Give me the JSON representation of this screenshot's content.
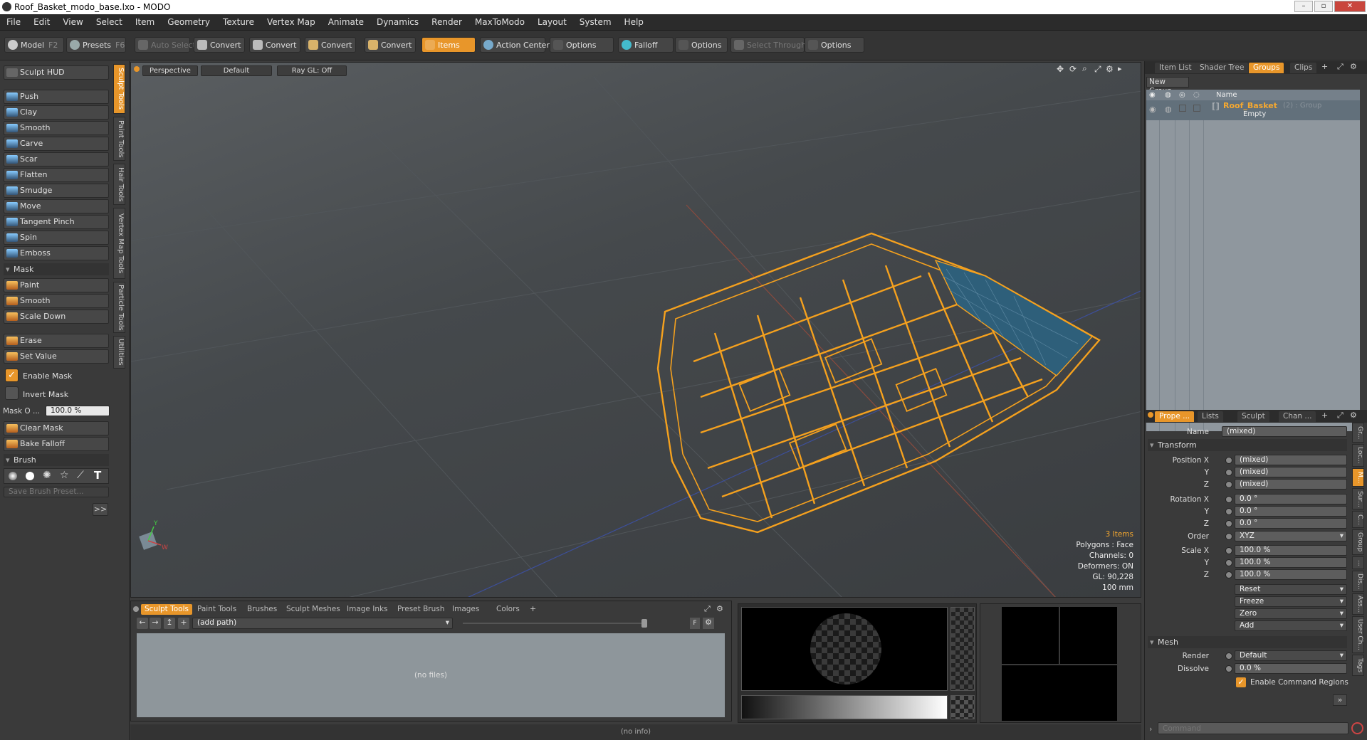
{
  "window": {
    "title": "Roof_Basket_modo_base.lxo - MODO"
  },
  "menu": [
    "File",
    "Edit",
    "View",
    "Select",
    "Item",
    "Geometry",
    "Texture",
    "Vertex Map",
    "Animate",
    "Dynamics",
    "Render",
    "MaxToModo",
    "Layout",
    "System",
    "Help"
  ],
  "toolbar": {
    "model": "Model",
    "model_key": "F2",
    "presets": "Presets",
    "presets_key": "F6",
    "auto_select": "Auto Select",
    "convert1": "Convert",
    "convert2": "Convert",
    "convert3": "Convert",
    "convert4": "Convert",
    "items": "Items",
    "action_center": "Action Center",
    "options1": "Options",
    "falloff": "Falloff",
    "options2": "Options",
    "select_through": "Select Through",
    "options3": "Options"
  },
  "left": {
    "sculpt_hud": "Sculpt HUD",
    "tools": [
      "Push",
      "Clay",
      "Smooth",
      "Carve",
      "Scar",
      "Flatten",
      "Smudge",
      "Move",
      "Tangent Pinch",
      "Spin",
      "Emboss"
    ],
    "mask_header": "Mask",
    "mask_tools": [
      "Paint",
      "Smooth",
      "Scale Down"
    ],
    "erase": "Erase",
    "set_value": "Set Value",
    "enable_mask": "Enable Mask",
    "invert_mask": "Invert Mask",
    "mask_opacity_label": "Mask O ...",
    "mask_opacity_value": "100.0 %",
    "clear_mask": "Clear Mask",
    "bake_falloff": "Bake Falloff",
    "brush_header": "Brush",
    "save_brush_placeholder": "Save Brush Preset...",
    "more": ">>",
    "vtabs": [
      "Sculpt Tools",
      "Paint Tools",
      "Hair Tools",
      "Vertex Map Tools",
      "Particle Tools",
      "Utilities"
    ]
  },
  "viewport": {
    "perspective": "Perspective",
    "default": "Default",
    "raygl": "Ray GL: Off",
    "info": {
      "items": "3 Items",
      "polygons": "Polygons : Face",
      "channels": "Channels: 0",
      "deformers": "Deformers: ON",
      "gl": "GL: 90,228",
      "scale": "100 mm"
    }
  },
  "right": {
    "tabs": [
      "Item List",
      "Shader Tree",
      "Groups",
      "Clips"
    ],
    "new_group": "New Group",
    "col_name": "Name",
    "group_name": "Roof_Basket",
    "group_meta": "(2) : Group",
    "group_sub": "Empty",
    "prop_tabs": [
      "Prope ...",
      "Lists",
      "Sculpt",
      "Chan ..."
    ],
    "name_label": "Name",
    "name_value": "(mixed)",
    "transform": "Transform",
    "position_x": "Position X",
    "y": "Y",
    "z": "Z",
    "pos_values": [
      "(mixed)",
      "(mixed)",
      "(mixed)"
    ],
    "rotation_x": "Rotation X",
    "rot_values": [
      "0.0 °",
      "0.0 °",
      "0.0 °"
    ],
    "order_label": "Order",
    "order_value": "XYZ",
    "scale_x": "Scale X",
    "scale_values": [
      "100.0 %",
      "100.0 %",
      "100.0 %"
    ],
    "reset": "Reset",
    "freeze": "Freeze",
    "zero": "Zero",
    "add": "Add",
    "mesh": "Mesh",
    "render_label": "Render",
    "render_value": "Default",
    "dissolve_label": "Dissolve",
    "dissolve_value": "0.0 %",
    "enable_cmd_regions": "Enable Command Regions",
    "side_tabs": [
      "Gr...",
      "Loc...",
      "M...",
      "Sur...",
      "C...",
      "Group",
      "...",
      "Dis...",
      "Ass...",
      "User Ch...",
      "Tags"
    ],
    "command_placeholder": "Command"
  },
  "bottom": {
    "tabs": [
      "Sculpt Tools",
      "Paint Tools",
      "Brushes",
      "Sculpt Meshes",
      "Image Inks",
      "Preset Brush",
      "Images",
      "Colors"
    ],
    "path": "(add path)",
    "no_files": "(no files)"
  },
  "status": "(no info)"
}
